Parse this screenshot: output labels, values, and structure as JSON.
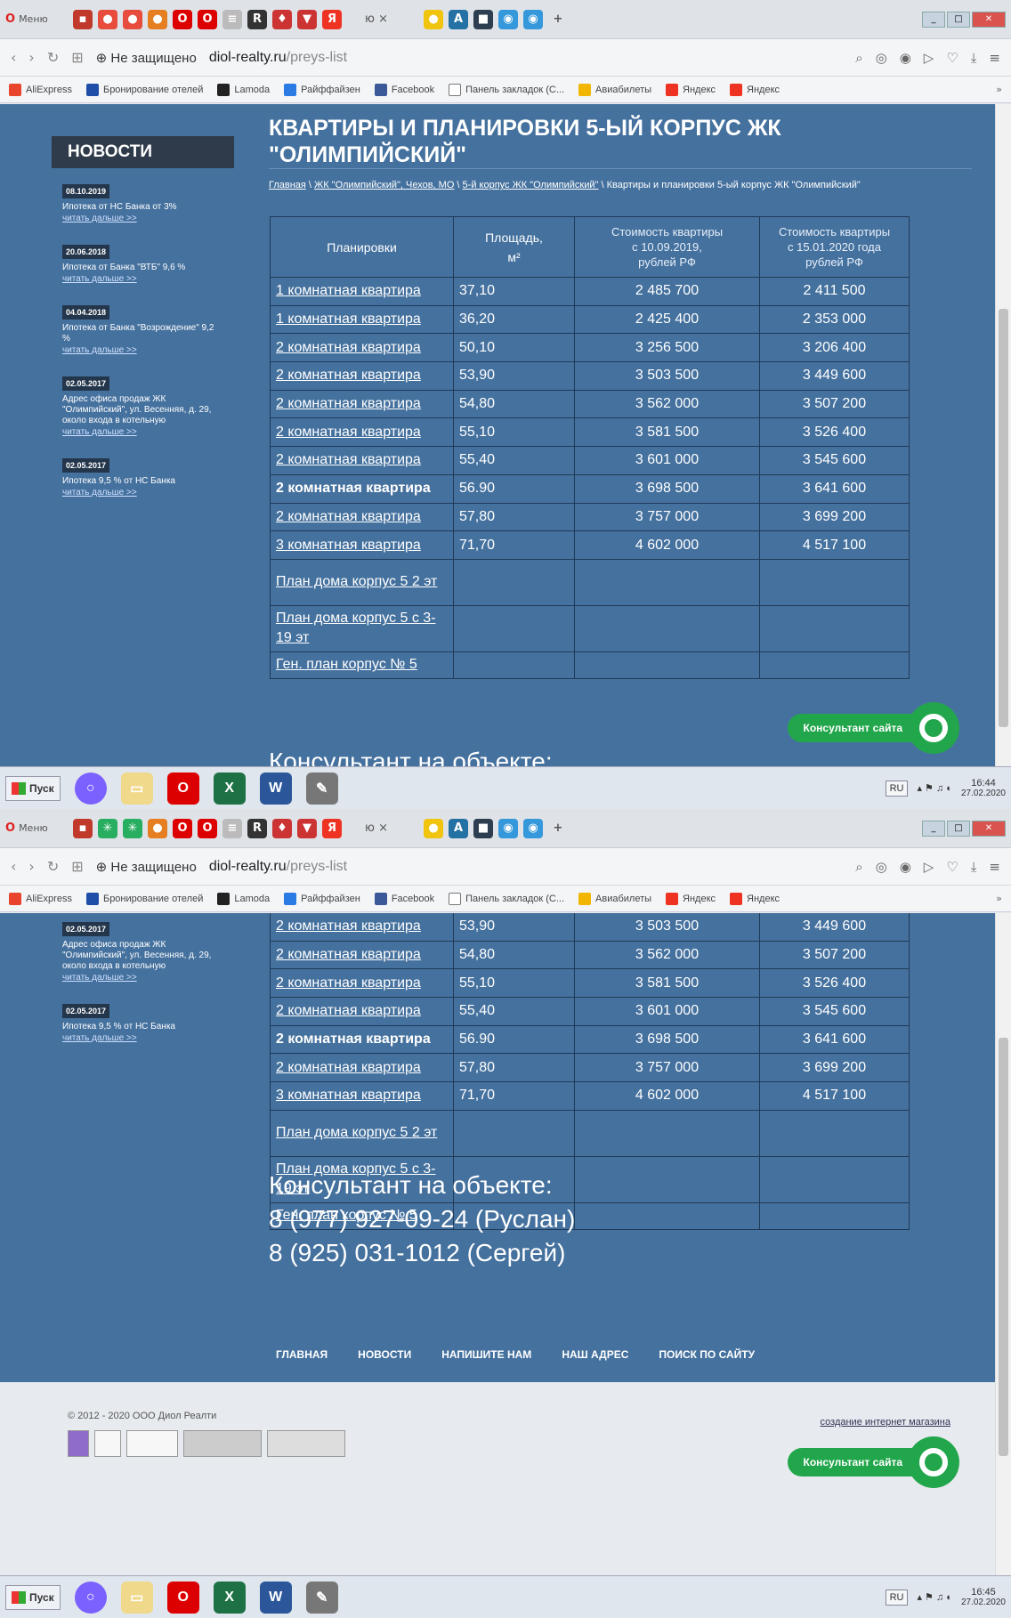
{
  "browser": {
    "menu_label": "Меню",
    "tab_close": "×",
    "address": {
      "secure_label": "Не защищено",
      "host": "diol-realty.ru",
      "path": "/preys-list"
    },
    "bookmarks": [
      {
        "label": "AliExpress",
        "color": "#e8452c"
      },
      {
        "label": "Бронирование отелей",
        "color": "#1f4ea8"
      },
      {
        "label": "Lamoda",
        "color": "#222222"
      },
      {
        "label": "Райффайзен",
        "color": "#2a7be4"
      },
      {
        "label": "Facebook",
        "color": "#3b5998"
      },
      {
        "label": "Панель закладок (С...",
        "color": "#ffffff"
      },
      {
        "label": "Авиабилеты",
        "color": "#f2b600"
      },
      {
        "label": "Яндекс",
        "color": "#e32"
      },
      {
        "label": "Яндекс",
        "color": "#e32"
      }
    ],
    "bookmarks_more": "»"
  },
  "sidebar": {
    "heading": "НОВОСТИ",
    "more_label": "читать дальше >>",
    "items": [
      {
        "date": "08.10.2019",
        "text": "Ипотека от НС Банка от 3%"
      },
      {
        "date": "20.06.2018",
        "text": "Ипотека от Банка \"ВТБ\" 9,6 %"
      },
      {
        "date": "04.04.2018",
        "text": "Ипотека от Банка \"Возрождение\" 9,2 %"
      },
      {
        "date": "02.05.2017",
        "text": "Адрес офиса продаж ЖК \"Олимпийский\", ул. Весенняя, д. 29, около входа в котельную"
      },
      {
        "date": "02.05.2017",
        "text": "Ипотека 9,5 % от НС Банка"
      }
    ]
  },
  "page": {
    "title": "КВАРТИРЫ И ПЛАНИРОВКИ 5-ЫЙ КОРПУС ЖК \"ОЛИМПИЙСКИЙ\"",
    "breadcrumb": [
      {
        "label": "Главная",
        "link": true
      },
      {
        "label": "ЖК \"Олимпийский\", Чехов, МО",
        "link": true
      },
      {
        "label": "5-й корпус ЖК \"Олимпийский\"",
        "link": true
      },
      {
        "label": "Квартиры и планировки 5-ый корпус ЖК \"Олимпийский\"",
        "link": false
      }
    ],
    "breadcrumb_sep": " \\ "
  },
  "table": {
    "headers": {
      "plan": "Планировки",
      "area_1": "Площадь,",
      "area_2": "м²",
      "price1_1": "Стоимость квартиры",
      "price1_2": "с 10.09.2019,",
      "price1_3": "рублей РФ",
      "price2_1": "Стоимость квартиры",
      "price2_2": "с 15.01.2020 года",
      "price2_3": "рублей РФ"
    },
    "rows": [
      {
        "plan": "1 комнатная квартира",
        "area": "37,10",
        "price1": "2 485 700",
        "price2": "2 411 500",
        "link": true
      },
      {
        "plan": "1 комнатная квартира",
        "area": "36,20",
        "price1": "2 425 400",
        "price2": "2 353 000",
        "link": true
      },
      {
        "plan": "2 комнатная квартира",
        "area": "50,10",
        "price1": "3 256 500",
        "price2": "3 206 400",
        "link": true
      },
      {
        "plan": "2 комнатная квартира",
        "area": "53,90",
        "price1": "3 503 500",
        "price2": "3 449 600",
        "link": true
      },
      {
        "plan": "2 комнатная квартира",
        "area": "54,80",
        "price1": "3 562 000",
        "price2": "3 507 200",
        "link": true
      },
      {
        "plan": "2 комнатная квартира",
        "area": "55,10",
        "price1": "3 581 500",
        "price2": "3 526 400",
        "link": true
      },
      {
        "plan": "2 комнатная квартира",
        "area": "55,40",
        "price1": "3 601 000",
        "price2": "3 545 600",
        "link": true
      },
      {
        "plan": "2 комнатная квартира",
        "area": "56.90",
        "price1": "3 698 500",
        "price2": "3 641 600",
        "link": false
      },
      {
        "plan": "2 комнатная квартира",
        "area": "57,80",
        "price1": "3 757 000",
        "price2": "3 699 200",
        "link": true
      },
      {
        "plan": "3 комнатная квартира",
        "area": "71,70",
        "price1": "4 602 000",
        "price2": "4 517 100",
        "link": true
      }
    ],
    "extra_rows": [
      "План дома корпус 5 2 эт",
      "План дома корпус 5 с 3-19 эт",
      "Ген. план корпус № 5"
    ]
  },
  "contact": {
    "heading": "Консультант на объекте:",
    "phone1": "8 (977) 927-09-24 (Руслан)",
    "phone2": "8 (925) 031-1012 (Сергей)"
  },
  "consultant_button": "Консультант сайта",
  "footer": {
    "nav": [
      "ГЛАВНАЯ",
      "НОВОСТИ",
      "НАПИШИТЕ НАМ",
      "НАШ АДРЕС",
      "ПОИСК ПО САЙТУ"
    ],
    "copyright": "© 2012 - 2020 ООО Диол Реалти",
    "maker_link": "создание интернет магазина"
  },
  "taskbar": {
    "start_label": "Пуск",
    "lang": "RU",
    "shot1_time": "16:44",
    "shot1_date": "27.02.2020",
    "shot2_time": "16:45",
    "shot2_date": "27.02.2020"
  },
  "colors": {
    "page_bg": "#45719e",
    "consult_green": "#22a64b",
    "news_head": "#2f3b4a"
  }
}
